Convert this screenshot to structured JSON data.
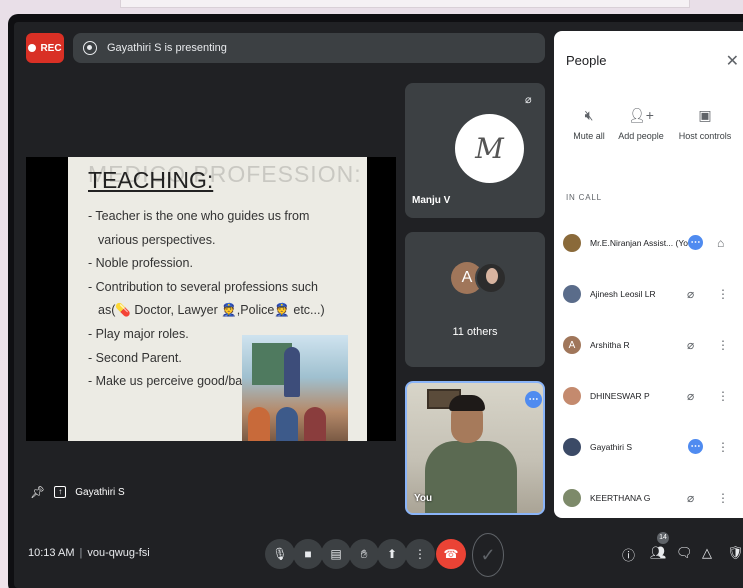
{
  "recording": {
    "label": "REC"
  },
  "presentation_bar": {
    "text": "Gayathiri S is presenting"
  },
  "slide": {
    "ghost_title": "MEDICO PROFESSION:",
    "title": "TEACHING:",
    "bullets": [
      "- Teacher is the one who guides us from",
      "  various perspectives.",
      "- Noble profession.",
      "- Contribution to several professions such",
      "  as(💊 Doctor, Lawyer 👮,Police👮 etc...)",
      "- Play major roles.",
      "- Second Parent.",
      "- Make us perceive good/bad."
    ]
  },
  "tiles": [
    {
      "name": "Manju V",
      "logo": "M"
    },
    {
      "avatar_letter": "A",
      "label": "11 others"
    },
    {
      "name": "You"
    }
  ],
  "pinned": {
    "name": "Gayathiri S"
  },
  "people_panel": {
    "title": "People",
    "actions": [
      {
        "label": "Mute all",
        "icon": "mic-off-icon"
      },
      {
        "label": "Add people",
        "icon": "add-person-icon"
      },
      {
        "label": "Host controls",
        "icon": "host-controls-icon"
      }
    ],
    "section_label": "IN CALL",
    "participants": [
      {
        "name": "Mr.E.Niranjan Assist... (You)",
        "avatar": "",
        "color": "#8a6a3a"
      },
      {
        "name": "Ajinesh Leosil LR",
        "avatar": "",
        "color": "#5a6c8a"
      },
      {
        "name": "Arshitha R",
        "avatar": "A",
        "color": "#a0765a"
      },
      {
        "name": "DHINESWAR P",
        "avatar": "",
        "color": "#c48a6e"
      },
      {
        "name": "Gayathiri S",
        "avatar": "",
        "color": "#3b4a66"
      },
      {
        "name": "KEERTHANA G",
        "avatar": "",
        "color": "#7d8a6a"
      }
    ]
  },
  "bottom_bar": {
    "time": "10:13 AM",
    "meeting_code": "vou-qwug-fsi",
    "participant_count": "14"
  }
}
